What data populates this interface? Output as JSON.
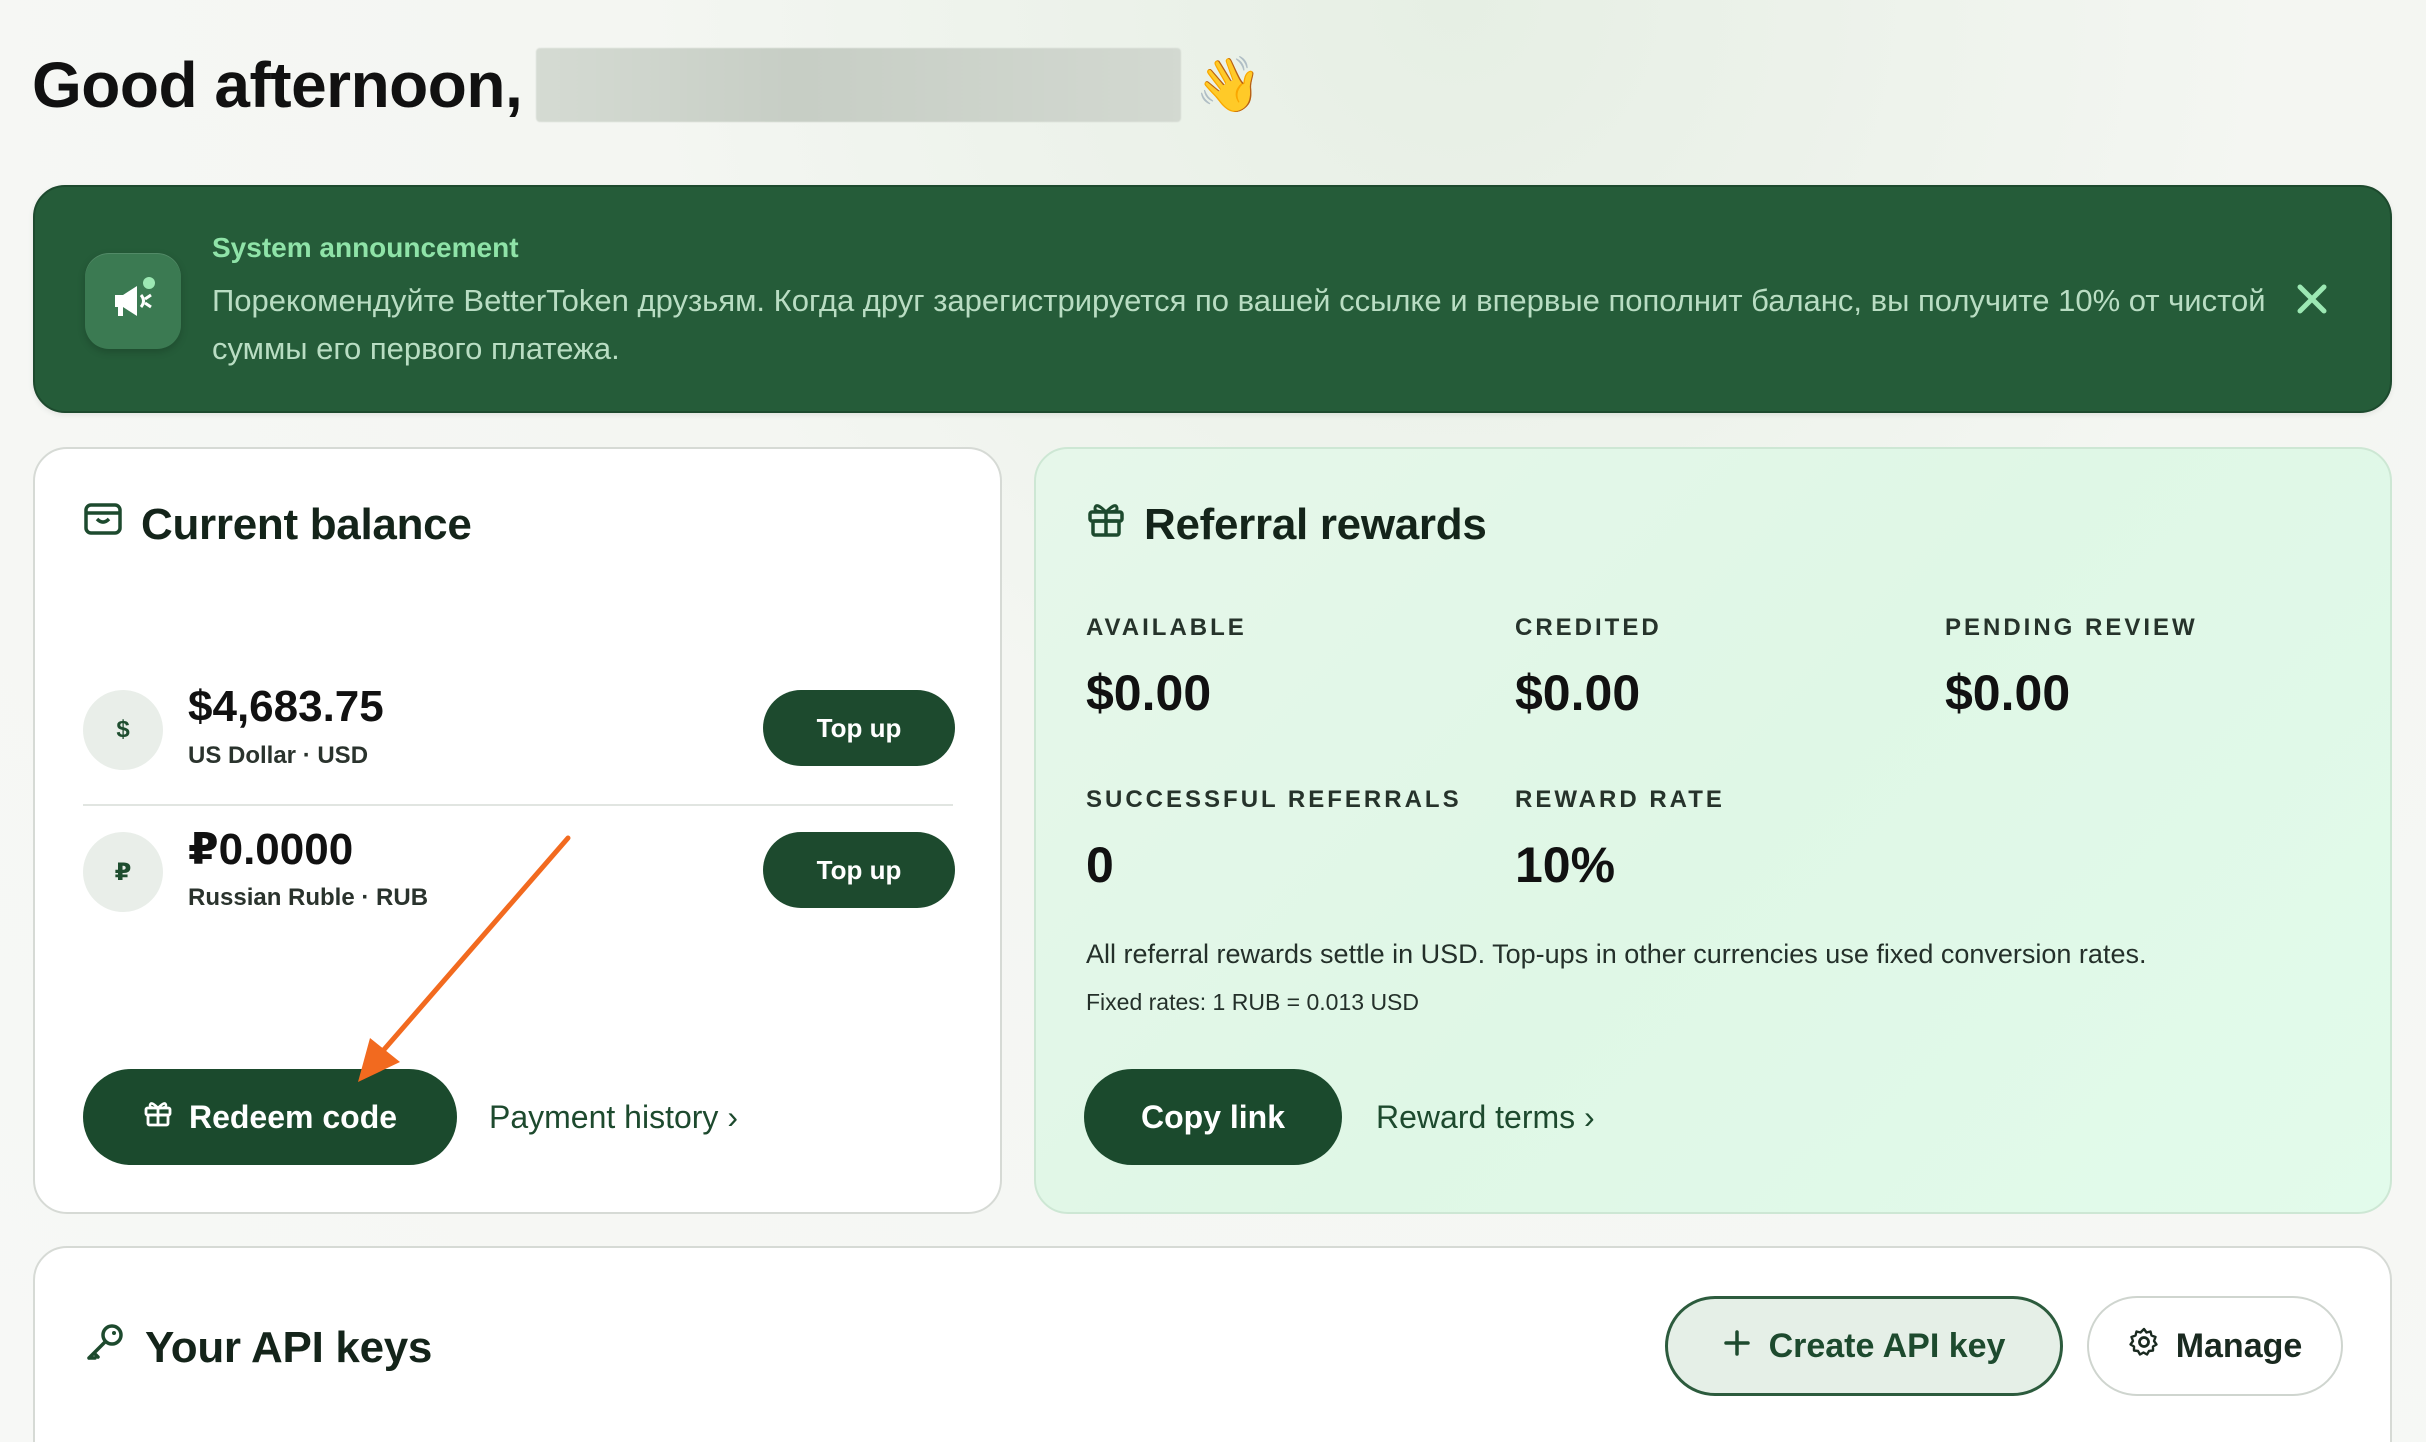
{
  "greeting": {
    "text": "Good afternoon,",
    "emoji": "👋"
  },
  "announcement": {
    "title": "System announcement",
    "message": "Порекомендуйте BetterToken друзьям. Когда друг зарегистрируется по вашей ссылке и впервые пополнит баланс, вы получите 10% от чистой суммы его первого платежа.",
    "close_icon": "close-icon",
    "icon": "megaphone-icon"
  },
  "balance": {
    "title": "Current balance",
    "icon": "wallet-icon",
    "rows": [
      {
        "symbol": "$",
        "amount": "$4,683.75",
        "label": "US Dollar · USD",
        "button": "Top up"
      },
      {
        "symbol": "₽",
        "amount": "₽0.0000",
        "label": "Russian Ruble · RUB",
        "button": "Top up"
      }
    ],
    "redeem_label": "Redeem code",
    "history_label": "Payment history ›"
  },
  "referral": {
    "title": "Referral rewards",
    "icon": "gift-icon",
    "stats": [
      {
        "label": "AVAILABLE",
        "value": "$0.00"
      },
      {
        "label": "CREDITED",
        "value": "$0.00"
      },
      {
        "label": "PENDING REVIEW",
        "value": "$0.00"
      },
      {
        "label": "SUCCESSFUL REFERRALS",
        "value": "0"
      },
      {
        "label": "REWARD RATE",
        "value": "10%"
      }
    ],
    "note": "All referral rewards settle in USD. Top-ups in other currencies use fixed conversion rates.",
    "rates": "Fixed rates: 1 RUB = 0.013 USD",
    "copy_label": "Copy link",
    "terms_label": "Reward terms ›"
  },
  "api_keys": {
    "title": "Your API keys",
    "icon": "key-icon",
    "create_label": "Create API key",
    "manage_label": "Manage"
  },
  "colors": {
    "primary": "#1b4a2d",
    "announcement_bg": "#255c39",
    "accent_green": "#8fe3a8",
    "annotation_arrow": "#f26a1f"
  }
}
